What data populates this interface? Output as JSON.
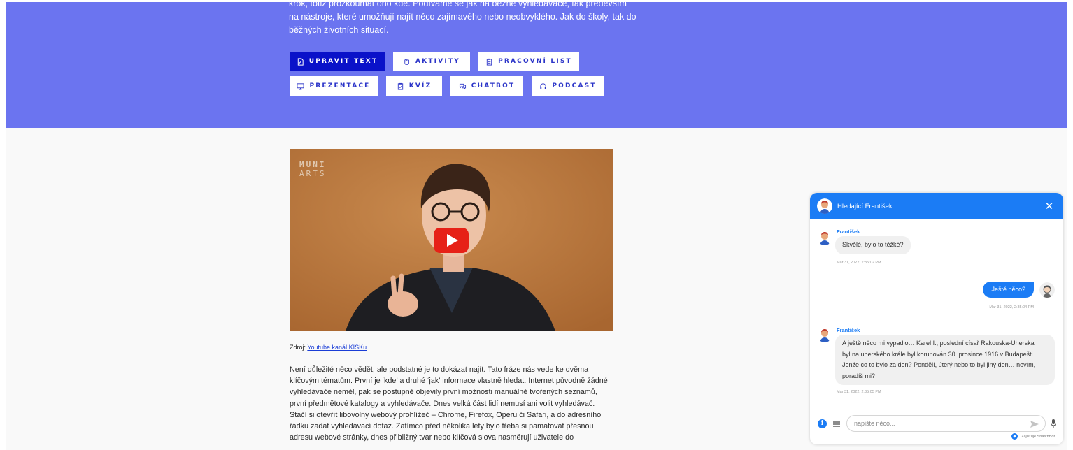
{
  "hero": {
    "lines": [
      "krok, totiž prozkoumat ono kde. Podíváme se jak na běžné vyhledávače, tak především",
      "na nástroje, které umožňují najít něco zajímavého nebo neobvyklého. Jak do školy, tak do",
      "běžných životních situací."
    ],
    "buttons": [
      {
        "label": "UPRAVIT TEXT",
        "icon": "edit-doc-icon"
      },
      {
        "label": "AKTIVITY",
        "icon": "hand-icon"
      },
      {
        "label": "PRACOVNÍ LIST",
        "icon": "clipboard-icon"
      },
      {
        "label": "PREZENTACE",
        "icon": "monitor-icon"
      },
      {
        "label": "KVÍZ",
        "icon": "checklist-icon"
      },
      {
        "label": "CHATBOT",
        "icon": "chat-bubbles-icon"
      },
      {
        "label": "PODCAST",
        "icon": "headphones-icon"
      }
    ]
  },
  "video": {
    "logo_line1": "MUNI",
    "logo_line2": "ARTS"
  },
  "source": {
    "prefix": "Zdroj: ",
    "link": "Youtube kanál KISKu"
  },
  "article": {
    "lines": [
      "Není důležité něco vědět, ale podstatné je to dokázat najít. Tato fráze nás vede ke dvěma",
      "klíčovým tématům. První je ‘kde’ a druhé ‘jak’ informace vlastně hledat. Internet původně žádné",
      "vyhledávače neměl, pak se postupně objevily první možnosti manuálně tvořených seznamů,",
      "první předmětové katalogy a vyhledávače. Dnes velká část lidí nemusí ani volit vyhledávač.",
      "Stačí si otevřít libovolný webový prohlížeč – Chrome, Firefox, Operu či Safari, a do adresního",
      "řádku zadat vyhledávací dotaz. Zatímco před několika lety bylo třeba si pamatovat přesnou",
      "adresu webové stránky, dnes přibližný tvar nebo klíčová slova nasměrují uživatele do"
    ]
  },
  "chat": {
    "title": "Hledající František",
    "messages": [
      {
        "from": "bot",
        "name": "František",
        "text": "Skvělé, bylo to těžké?",
        "time": "Mar 31, 2022, 2:35:02 PM"
      },
      {
        "from": "user",
        "text": "Ještě něco?",
        "time": "Mar 31, 2022, 2:35:04 PM"
      },
      {
        "from": "bot",
        "name": "František",
        "lines": [
          "A ještě něco mi vypadlo… Karel I., poslední císař Rakouska-Uherska",
          "byl na uherského krále byl korunován 30. prosince 1916 v Budapešti.",
          "Jenže co to bylo za den? Pondělí, úterý nebo to byl jiný den… nevím,",
          "poradíš mi?"
        ],
        "time": "Mar 31, 2022, 2:35:05 PM"
      }
    ],
    "input_placeholder": "napište něco...",
    "powered_by": "Zajišťuje SnatchBot"
  },
  "colors": {
    "hero_bg": "#6b74f0",
    "active_button": "#0a12c9",
    "chat_accent": "#1b7cf5"
  }
}
